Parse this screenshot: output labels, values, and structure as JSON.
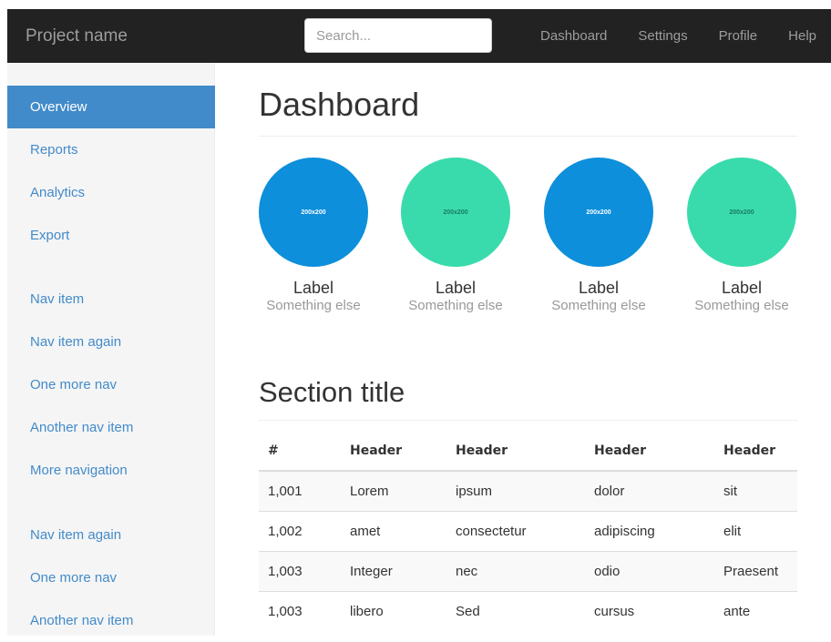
{
  "navbar": {
    "brand": "Project name",
    "search_placeholder": "Search...",
    "links": [
      "Dashboard",
      "Settings",
      "Profile",
      "Help"
    ]
  },
  "sidebar": {
    "group1": [
      "Overview",
      "Reports",
      "Analytics",
      "Export"
    ],
    "group2": [
      "Nav item",
      "Nav item again",
      "One more nav",
      "Another nav item",
      "More navigation"
    ],
    "group3": [
      "Nav item again",
      "One more nav",
      "Another nav item"
    ],
    "active_item": "Overview"
  },
  "main": {
    "title": "Dashboard",
    "placeholders": [
      {
        "image_text": "200x200",
        "label": "Label",
        "sub": "Something else",
        "color": "#0d8fdb",
        "text_color": "#ffffff"
      },
      {
        "image_text": "200x200",
        "label": "Label",
        "sub": "Something else",
        "color": "#39dbac",
        "text_color": "#1b7a5f"
      },
      {
        "image_text": "200x200",
        "label": "Label",
        "sub": "Something else",
        "color": "#0d8fdb",
        "text_color": "#ffffff"
      },
      {
        "image_text": "200x200",
        "label": "Label",
        "sub": "Something else",
        "color": "#39dbac",
        "text_color": "#1b7a5f"
      }
    ],
    "section_title": "Section title",
    "table": {
      "headers": [
        "#",
        "Header",
        "Header",
        "Header",
        "Header"
      ],
      "rows": [
        [
          "1,001",
          "Lorem",
          "ipsum",
          "dolor",
          "sit"
        ],
        [
          "1,002",
          "amet",
          "consectetur",
          "adipiscing",
          "elit"
        ],
        [
          "1,003",
          "Integer",
          "nec",
          "odio",
          "Praesent"
        ],
        [
          "1,003",
          "libero",
          "Sed",
          "cursus",
          "ante"
        ]
      ]
    }
  },
  "colors": {
    "navbar_bg": "#222222",
    "accent": "#428bca",
    "sidebar_bg": "#f5f5f5"
  }
}
